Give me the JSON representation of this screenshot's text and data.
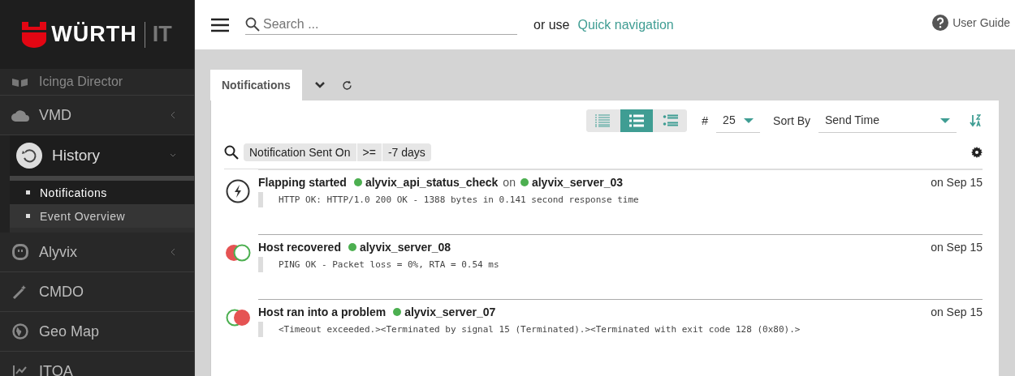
{
  "brand": {
    "name": "WÜRTH",
    "suffix": "IT"
  },
  "sidebar": {
    "items": [
      {
        "label": "Icinga Director",
        "expanded": false,
        "has_children": false
      },
      {
        "label": "VMD",
        "expanded": false,
        "has_children": true
      },
      {
        "label": "History",
        "expanded": true,
        "has_children": true,
        "children": [
          {
            "label": "Notifications",
            "selected": true
          },
          {
            "label": "Event Overview",
            "selected": false
          }
        ]
      },
      {
        "label": "Alyvix",
        "expanded": false,
        "has_children": true
      },
      {
        "label": "CMDO",
        "expanded": false,
        "has_children": false
      },
      {
        "label": "Geo Map",
        "expanded": false,
        "has_children": false
      },
      {
        "label": "ITOA",
        "expanded": false,
        "has_children": false
      }
    ]
  },
  "header": {
    "search": {
      "placeholder": "Search ..."
    },
    "or_use": "or use",
    "quick_nav": "Quick navigation",
    "user_guide": "User Guide"
  },
  "tabs": [
    {
      "label": "Notifications",
      "selected": true
    }
  ],
  "toolbar": {
    "view_modes": [
      {
        "kind": "minimal",
        "selected": false
      },
      {
        "kind": "default",
        "selected": true
      },
      {
        "kind": "detailed",
        "selected": false
      }
    ],
    "limit_label": "#",
    "limit": "25",
    "sort_label": "Sort By",
    "sort": "Send Time"
  },
  "filter": [
    "Notification Sent On",
    ">=",
    "-7 days"
  ],
  "notifications": [
    {
      "kind": "flapping",
      "title": "Flapping started",
      "service": "alyvix_api_status_check",
      "on": "on",
      "host": "alyvix_server_03",
      "time": "on Sep 15",
      "output": "HTTP OK: HTTP/1.0 200 OK - 1388 bytes in 0.141 second response time"
    },
    {
      "kind": "recovered",
      "title": "Host recovered",
      "host": "alyvix_server_08",
      "time": "on Sep 15",
      "output": "PING OK - Packet loss = 0%, RTA = 0.54 ms"
    },
    {
      "kind": "problem",
      "title": "Host ran into a problem",
      "host": "alyvix_server_07",
      "time": "on Sep 15",
      "output": "<Timeout exceeded.><Terminated by signal 15 (Terminated).><Terminated with exit code 128 (0x80).>"
    }
  ]
}
